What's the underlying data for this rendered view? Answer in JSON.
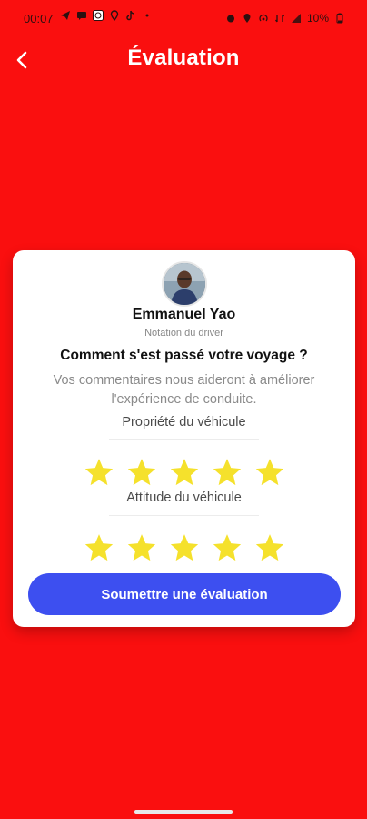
{
  "status_bar": {
    "time": "00:07",
    "battery": "10%"
  },
  "header": {
    "title": "Évaluation",
    "back_icon": "chevron-left-icon"
  },
  "card": {
    "driver_name": "Emmanuel Yao",
    "driver_subtitle": "Notation du driver",
    "question": "Comment s'est passé votre voyage ?",
    "subtext_line1": "Vos commentaires nous aideront à améliorer",
    "subtext_line2": "l'expérience de conduite.",
    "ratings": [
      {
        "label": "Propriété du véhicule",
        "stars": 5,
        "max": 5
      },
      {
        "label": "Attitude du véhicule",
        "stars": 5,
        "max": 5
      }
    ],
    "submit_label": "Soumettre une évaluation"
  },
  "colors": {
    "background": "#FA0F0F",
    "star": "#F5E12C",
    "button": "#3D4FF0"
  }
}
